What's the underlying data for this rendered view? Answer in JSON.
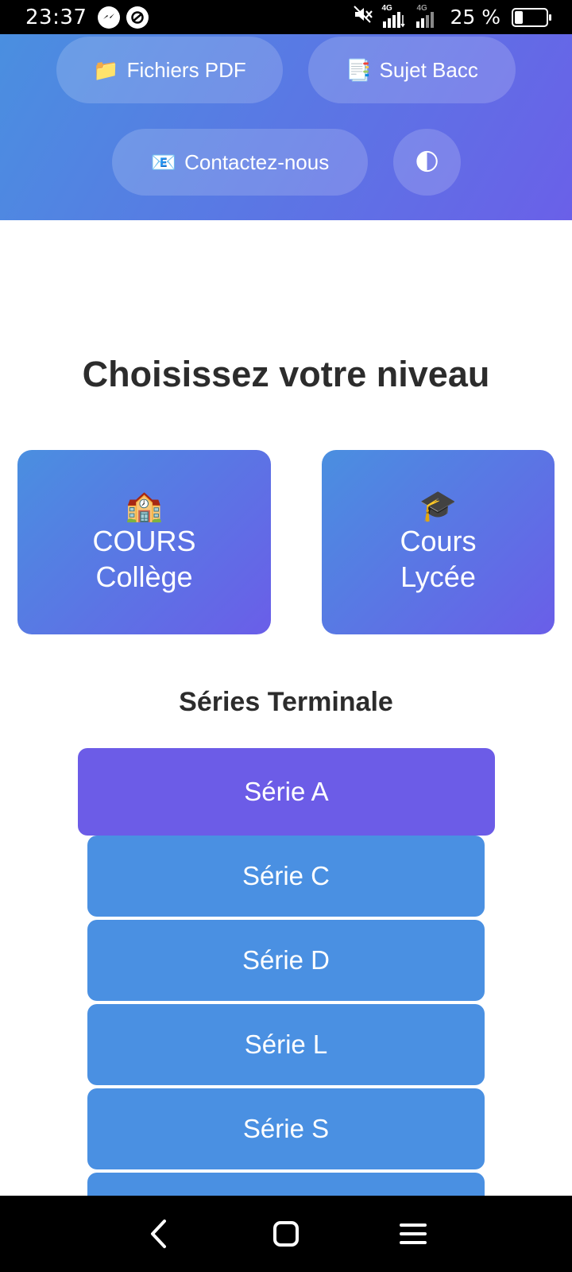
{
  "status_bar": {
    "time": "23:37",
    "network_label_1": "4G",
    "network_label_2": "4G",
    "battery_text": "25 %",
    "battery_level": 0.25
  },
  "nav": {
    "pdf": {
      "icon": "📁",
      "label": "Fichiers PDF"
    },
    "bacc": {
      "icon": "📑",
      "label": "Sujet Bacc"
    },
    "contact": {
      "icon": "📧",
      "label": "Contactez-nous"
    },
    "theme": {
      "icon": "🌓"
    }
  },
  "main": {
    "title": "Choisissez votre niveau",
    "levels": [
      {
        "icon": "🏫",
        "line1": "COURS",
        "line2": "Collège"
      },
      {
        "icon": "🎓",
        "line1": "Cours",
        "line2": "Lycée"
      }
    ],
    "series_title": "Séries Terminale",
    "series": [
      "Série A",
      "Série C",
      "Série D",
      "Série L",
      "Série S",
      ""
    ]
  },
  "colors": {
    "gradient_start": "#4a8fe0",
    "gradient_end": "#6a60e8",
    "active_series": "#6c5ce7",
    "series": "#4a90e2"
  }
}
